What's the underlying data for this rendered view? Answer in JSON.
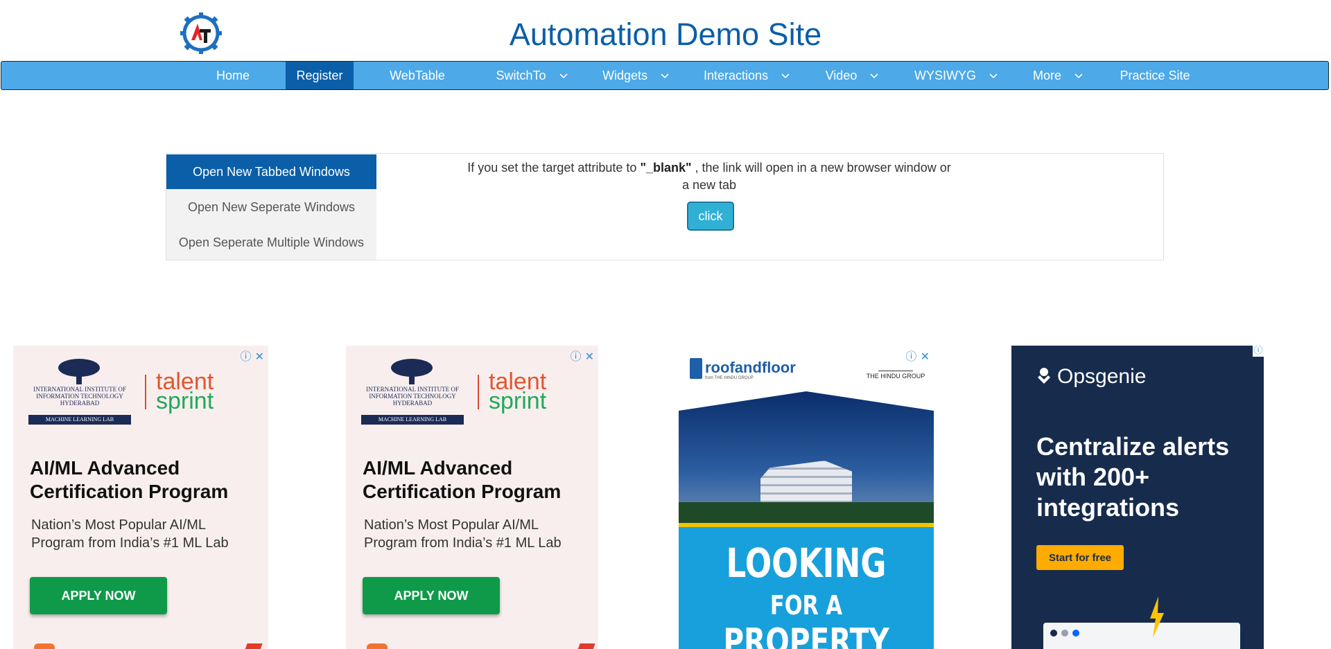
{
  "site": {
    "title": "Automation Demo Site",
    "logo_letters": "AT"
  },
  "nav": {
    "items": [
      {
        "label": "Home",
        "has_dropdown": false,
        "active": false
      },
      {
        "label": "Register",
        "has_dropdown": false,
        "active": true
      },
      {
        "label": "WebTable",
        "has_dropdown": false,
        "active": false
      },
      {
        "label": "SwitchTo",
        "has_dropdown": true,
        "active": false
      },
      {
        "label": "Widgets",
        "has_dropdown": true,
        "active": false
      },
      {
        "label": "Interactions",
        "has_dropdown": true,
        "active": false
      },
      {
        "label": "Video",
        "has_dropdown": true,
        "active": false
      },
      {
        "label": "WYSIWYG",
        "has_dropdown": true,
        "active": false
      },
      {
        "label": "More",
        "has_dropdown": true,
        "active": false
      },
      {
        "label": "Practice Site",
        "has_dropdown": false,
        "active": false
      }
    ]
  },
  "windows": {
    "tabs": [
      {
        "label": "Open New Tabbed Windows",
        "active": true
      },
      {
        "label": "Open New Seperate Windows",
        "active": false
      },
      {
        "label": "Open Seperate Multiple Windows",
        "active": false
      }
    ],
    "description_pre": "If you set the target attribute to ",
    "description_bold": "\"_blank\"",
    "description_post": " , the link will open in a new browser window or a new tab",
    "button_label": "click"
  },
  "ads": {
    "ml": {
      "iiit_name": "INTERNATIONAL INSTITUTE OF INFORMATION TECHNOLOGY",
      "iiit_city": "HYDERABAD",
      "iiit_lab": "MACHINE LEARNING LAB",
      "brand_talent": "talent",
      "brand_sprint": "sprint",
      "headline": "AI/ML Advanced Certification Program",
      "subline": "Nation’s Most Popular AI/ML Program from India’s #1 ML Lab",
      "cta": "APPLY NOW"
    },
    "property": {
      "brand": "roofandfloor",
      "brand_sub": "from THE HINDU GROUP",
      "partner": "THE HINDU GROUP",
      "line1": "LOOKING",
      "line2": "FOR A",
      "line3": "PROPERTY"
    },
    "opsgenie": {
      "brand": "Opsgenie",
      "headline": "Centralize alerts with 200+ integrations",
      "cta": "Start for free"
    },
    "close_glyph": "ⓘ ✕",
    "info_glyph": "ⓘ"
  },
  "colors": {
    "nav_bg": "#4da9e8",
    "nav_active": "#0b5ea8",
    "title": "#0b5ea8",
    "button": "#31b0d5"
  }
}
